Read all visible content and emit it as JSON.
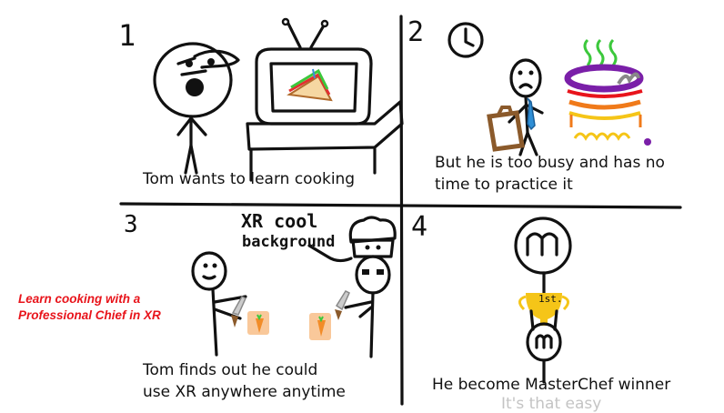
{
  "header": {
    "cropped_title": ""
  },
  "panels": [
    {
      "number": "1",
      "caption": "Tom wants to learn cooking"
    },
    {
      "number": "2",
      "caption_line1": "But he is too busy and has no",
      "caption_line2": "time to practice it"
    },
    {
      "number": "3",
      "hand_line1": "XR cool",
      "hand_line2": "background",
      "caption_line1": "Tom finds out he could",
      "caption_line2": "use XR anywhere anytime"
    },
    {
      "number": "4",
      "trophy_text": "1st.",
      "caption": "He become MasterChef winner"
    }
  ],
  "side_note": {
    "line1": "Learn cooking with a",
    "line2": "Professional Chief in XR"
  },
  "footer": {
    "tagline": "It's that easy"
  },
  "colors": {
    "accent_red": "#e8141b",
    "ink": "#111111",
    "tie_blue": "#2f8fd6",
    "pot_purple": "#7a1fa8",
    "pot_orange": "#f07a1a",
    "trophy_gold": "#f5c518",
    "carrot_orange": "#f28c28",
    "board_peach": "#f9c89a",
    "briefcase_brown": "#8b5a2b",
    "steam_green": "#3cc83c"
  },
  "icons": [
    "tv-icon",
    "sandwich-icon",
    "clock-icon",
    "briefcase-icon",
    "pot-icon",
    "chef-hat-icon",
    "knife-icon",
    "carrot-icon",
    "masterchef-logo-icon",
    "trophy-icon"
  ]
}
